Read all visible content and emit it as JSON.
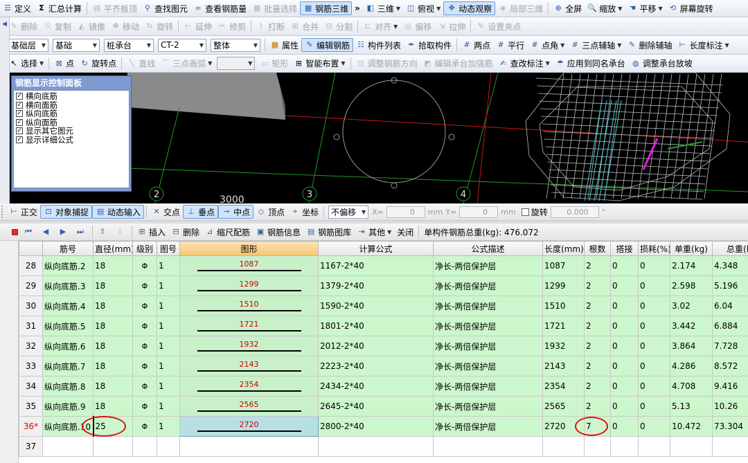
{
  "toolbar1": {
    "items": [
      "定义",
      "汇总计算",
      "平齐板顶",
      "查找图元",
      "查看钢筋量",
      "批量选择",
      "钢筋三维",
      "三维",
      "俯视",
      "动态观察",
      "局部三维",
      "全屏",
      "缩放",
      "平移",
      "屏幕旋转"
    ]
  },
  "toolbar2": {
    "items": [
      "删除",
      "复制",
      "镜像",
      "移动",
      "旋转",
      "延伸",
      "修剪",
      "打断",
      "合并",
      "分割",
      "对齐",
      "偏移",
      "拉伸",
      "设置夹点"
    ]
  },
  "toolbar3": {
    "layer": "基础层",
    "floor": "基础",
    "type": "桩承台",
    "name": "CT-2",
    "scope": "整体",
    "items": [
      "属性",
      "编辑钢筋",
      "构件列表",
      "拾取构件",
      "两点",
      "平行",
      "点角",
      "三点辅轴",
      "删除辅轴",
      "长度标注"
    ]
  },
  "toolbar4": {
    "items": [
      "选择",
      "点",
      "旋转点",
      "直线",
      "三点画弧",
      "矩形",
      "智能布置",
      "调整钢筋方向",
      "编辑承台加强筋",
      "查改标注",
      "应用到同名承台",
      "调整承台放坡"
    ]
  },
  "control_panel": {
    "title": "钢筋显示控制面板",
    "options": [
      "横向底筋",
      "横向面筋",
      "纵向底筋",
      "纵向面筋",
      "显示其它图元",
      "显示详细公式"
    ]
  },
  "viewport": {
    "dimension": "3000",
    "axis_labels": [
      "2",
      "3",
      "4"
    ]
  },
  "snapbar": {
    "items": [
      "正交",
      "对象捕捉",
      "动态输入",
      "交点",
      "垂点",
      "中点",
      "顶点",
      "坐标"
    ],
    "offset_mode": "不偏移",
    "x_label": "X=",
    "x_value": "0",
    "x_unit": "mm",
    "y_label": "Y=",
    "y_value": "0",
    "y_unit": "mm",
    "rotate_label": "旋转",
    "rotate_value": "0.000",
    "rotate_unit": "°"
  },
  "table_toolbar": {
    "items": [
      "插入",
      "删除",
      "缩尺配筋",
      "钢筋信息",
      "钢筋图库",
      "其他",
      "关闭"
    ],
    "total_weight": "单构件钢筋总重(kg): 476.072"
  },
  "table": {
    "headers": [
      "筋号",
      "直径(mm)",
      "级别",
      "图号",
      "图形",
      "计算公式",
      "公式描述",
      "长度(mm)",
      "根数",
      "搭接",
      "损耗(%)",
      "单重(kg)",
      "总重(kg)"
    ],
    "rows": [
      {
        "rn": "28",
        "name": "纵向底筋.2",
        "dia": "18",
        "grade": "Φ",
        "fig": "1",
        "shape": "1087",
        "formula": "1167-2*40",
        "desc": "净长-两倍保护层",
        "len": "1087",
        "count": "2",
        "lap": "0",
        "loss": "0",
        "unit_w": "2.174",
        "total_w": "4.348"
      },
      {
        "rn": "29",
        "name": "纵向底筋.3",
        "dia": "18",
        "grade": "Φ",
        "fig": "1",
        "shape": "1299",
        "formula": "1379-2*40",
        "desc": "净长-两倍保护层",
        "len": "1299",
        "count": "2",
        "lap": "0",
        "loss": "0",
        "unit_w": "2.598",
        "total_w": "5.196"
      },
      {
        "rn": "30",
        "name": "纵向底筋.4",
        "dia": "18",
        "grade": "Φ",
        "fig": "1",
        "shape": "1510",
        "formula": "1590-2*40",
        "desc": "净长-两倍保护层",
        "len": "1510",
        "count": "2",
        "lap": "0",
        "loss": "0",
        "unit_w": "3.02",
        "total_w": "6.04"
      },
      {
        "rn": "31",
        "name": "纵向底筋.5",
        "dia": "18",
        "grade": "Φ",
        "fig": "1",
        "shape": "1721",
        "formula": "1801-2*40",
        "desc": "净长-两倍保护层",
        "len": "1721",
        "count": "2",
        "lap": "0",
        "loss": "0",
        "unit_w": "3.442",
        "total_w": "6.884"
      },
      {
        "rn": "32",
        "name": "纵向底筋.6",
        "dia": "18",
        "grade": "Φ",
        "fig": "1",
        "shape": "1932",
        "formula": "2012-2*40",
        "desc": "净长-两倍保护层",
        "len": "1932",
        "count": "2",
        "lap": "0",
        "loss": "0",
        "unit_w": "3.864",
        "total_w": "7.728"
      },
      {
        "rn": "33",
        "name": "纵向底筋.7",
        "dia": "18",
        "grade": "Φ",
        "fig": "1",
        "shape": "2143",
        "formula": "2223-2*40",
        "desc": "净长-两倍保护层",
        "len": "2143",
        "count": "2",
        "lap": "0",
        "loss": "0",
        "unit_w": "4.286",
        "total_w": "8.572"
      },
      {
        "rn": "34",
        "name": "纵向底筋.8",
        "dia": "18",
        "grade": "Φ",
        "fig": "1",
        "shape": "2354",
        "formula": "2434-2*40",
        "desc": "净长-两倍保护层",
        "len": "2354",
        "count": "2",
        "lap": "0",
        "loss": "0",
        "unit_w": "4.708",
        "total_w": "9.416"
      },
      {
        "rn": "35",
        "name": "纵向底筋.9",
        "dia": "18",
        "grade": "Φ",
        "fig": "1",
        "shape": "2565",
        "formula": "2645-2*40",
        "desc": "净长-两倍保护层",
        "len": "2565",
        "count": "2",
        "lap": "0",
        "loss": "0",
        "unit_w": "5.13",
        "total_w": "10.26"
      },
      {
        "rn": "36*",
        "name": "纵向底筋.10",
        "dia": "25",
        "grade": "Φ",
        "fig": "1",
        "shape": "2720",
        "formula": "2800-2*40",
        "desc": "净长-两倍保护层",
        "len": "2720",
        "count": "7",
        "lap": "0",
        "loss": "0",
        "unit_w": "10.472",
        "total_w": "73.304"
      }
    ],
    "empty_row": "37"
  }
}
